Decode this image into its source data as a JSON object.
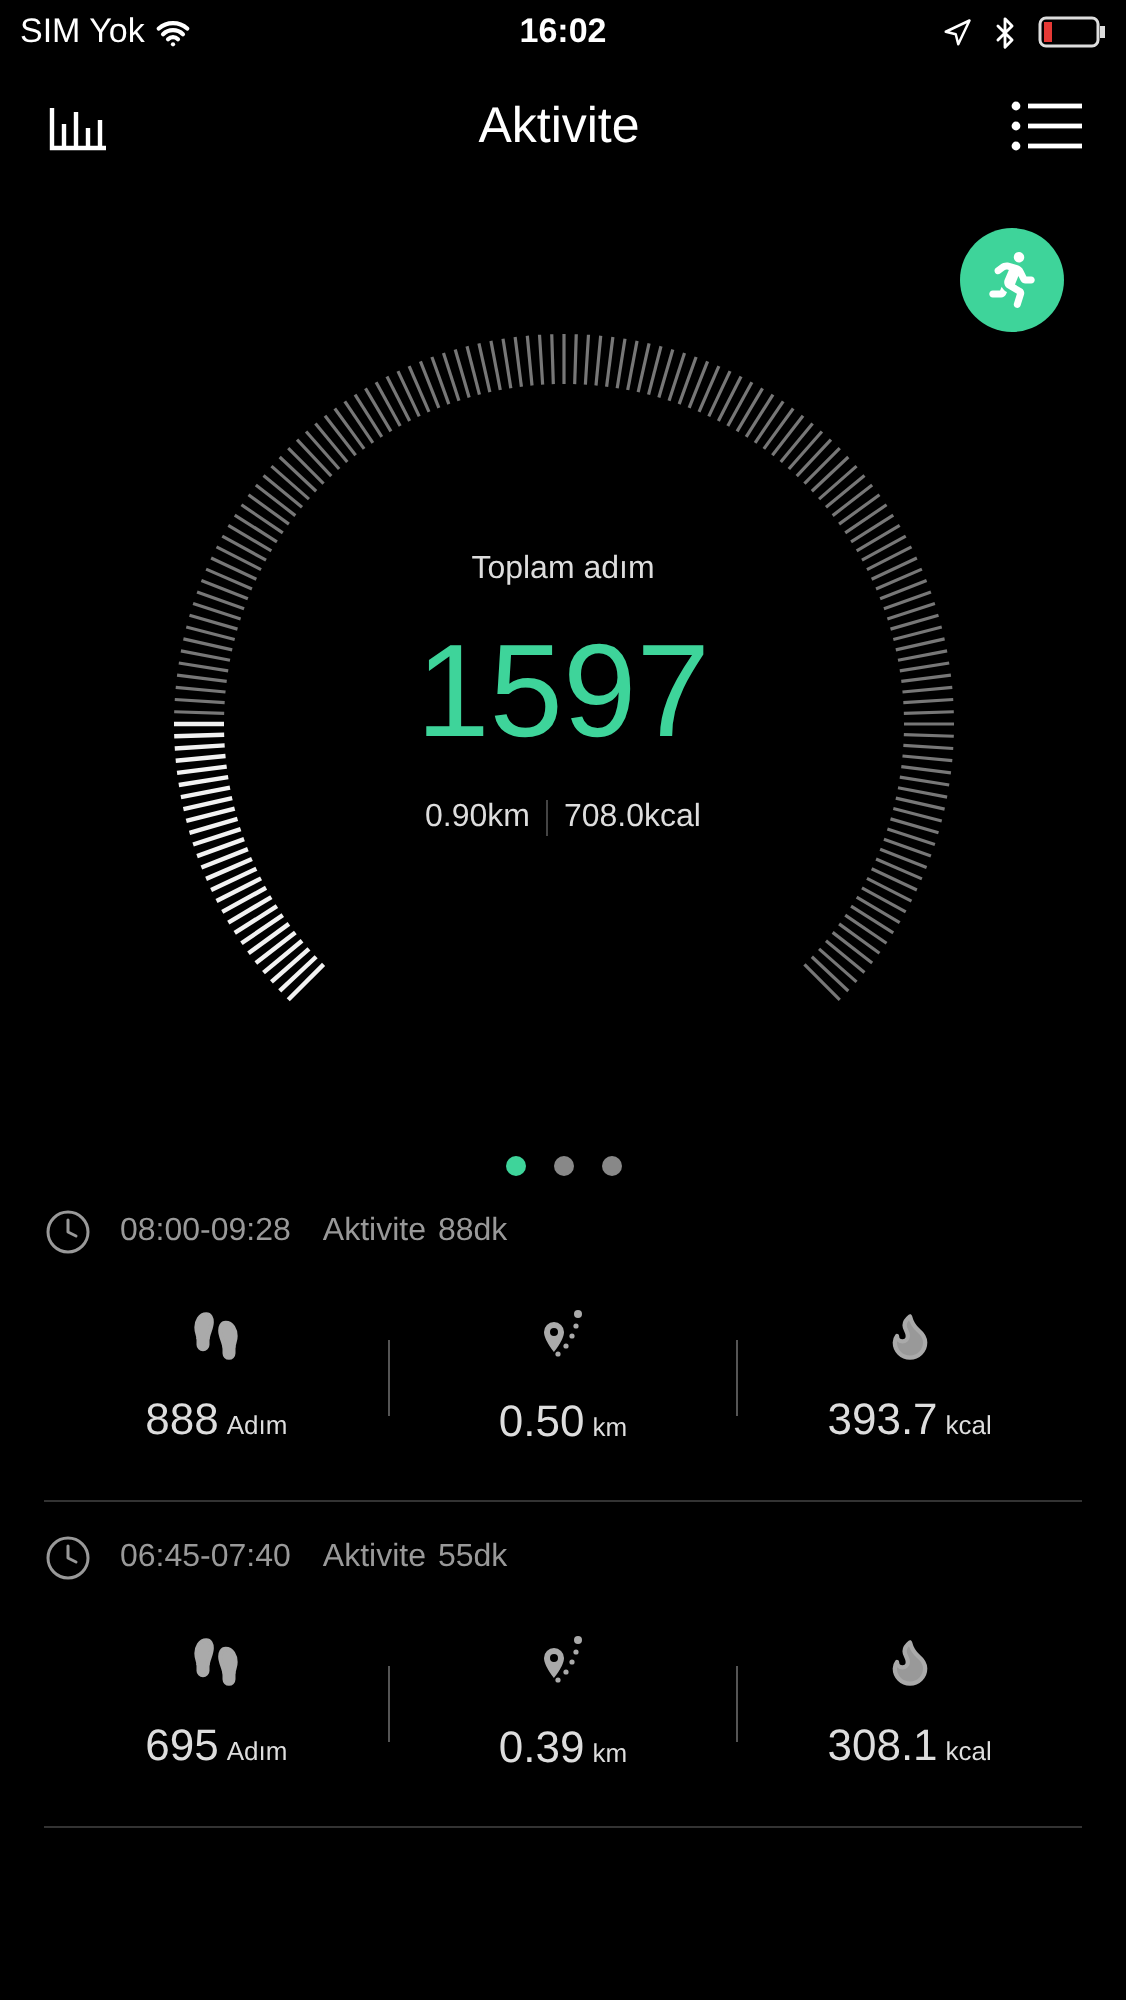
{
  "status_bar": {
    "carrier": "SIM Yok",
    "time": "16:02"
  },
  "header": {
    "title": "Aktivite"
  },
  "gauge": {
    "label": "Toplam adım",
    "steps": "1597",
    "distance": "0.90km",
    "calories": "708.0kcal"
  },
  "pager": [
    {
      "selected": true
    },
    {
      "selected": false
    },
    {
      "selected": false
    }
  ],
  "sessions": [
    {
      "time": "08:00-09:28",
      "label": "Aktivite",
      "duration": "88dk",
      "stats": [
        {
          "kind": "steps",
          "value": "888",
          "unit": "Adım"
        },
        {
          "kind": "distance",
          "value": "0.50",
          "unit": "km"
        },
        {
          "kind": "calories",
          "value": "393.7",
          "unit": "kcal"
        }
      ]
    },
    {
      "time": "06:45-07:40",
      "label": "Aktivite",
      "duration": "55dk",
      "stats": [
        {
          "kind": "steps",
          "value": "695",
          "unit": "Adım"
        },
        {
          "kind": "distance",
          "value": "0.39",
          "unit": "km"
        },
        {
          "kind": "calories",
          "value": "308.1",
          "unit": "kcal"
        }
      ]
    }
  ]
}
